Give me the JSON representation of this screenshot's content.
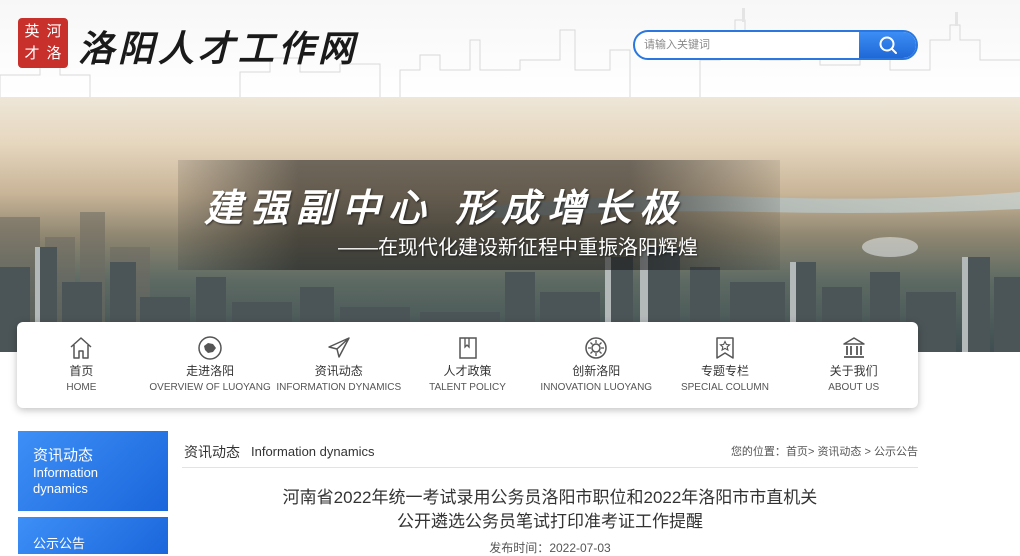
{
  "header": {
    "logo_chars": [
      "英",
      "河",
      "才",
      "洛"
    ],
    "site_title": "洛阳人才工作网",
    "search": {
      "placeholder": "请输入关键词",
      "value": ""
    }
  },
  "banner": {
    "slogan": "建强副中心 形成增长极",
    "subtitle": "——在现代化建设新征程中重振洛阳辉煌"
  },
  "nav": {
    "items": [
      {
        "cn": "首页",
        "en": "HOME",
        "icon": "home-icon"
      },
      {
        "cn": "走进洛阳",
        "en": "OVERVIEW OF LUOYANG",
        "icon": "map-icon"
      },
      {
        "cn": "资讯动态",
        "en": "INFORMATION DYNAMICS",
        "icon": "paper-plane-icon"
      },
      {
        "cn": "人才政策",
        "en": "TALENT POLICY",
        "icon": "book-icon"
      },
      {
        "cn": "创新洛阳",
        "en": "INNOVATION LUOYANG",
        "icon": "gear-icon"
      },
      {
        "cn": "专题专栏",
        "en": "SPECIAL COLUMN",
        "icon": "star-badge-icon"
      },
      {
        "cn": "关于我们",
        "en": "ABOUT US",
        "icon": "building-icon"
      }
    ]
  },
  "sidebar": {
    "active_cn": "资讯动态",
    "active_en_1": "Information",
    "active_en_2": "dynamics",
    "item": "公示公告"
  },
  "main": {
    "section_cn": "资讯动态",
    "section_en": "Information dynamics",
    "breadcrumb": {
      "prefix": "您的位置：",
      "home": "首页",
      "sep": ">",
      "section": "资讯动态",
      "current": "公示公告"
    },
    "article_title_1": "河南省2022年统一考试录用公务员洛阳市职位和2022年洛阳市市直机关",
    "article_title_2": "公开遴选公务员笔试打印准考证工作提醒",
    "publish_label": "发布时间：",
    "publish_date": "2022-07-03"
  },
  "colors": {
    "accent": "#1f6fe0",
    "seal": "#c8302c"
  }
}
